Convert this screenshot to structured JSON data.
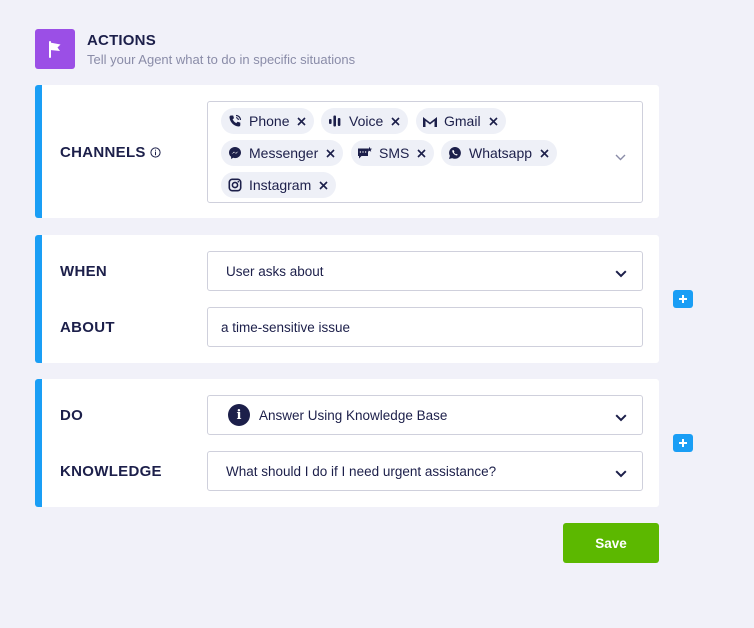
{
  "header": {
    "title": "ACTIONS",
    "subtitle": "Tell your Agent what to do in specific situations",
    "icon": "flag-icon",
    "icon_color": "#9b4fe6"
  },
  "channels": {
    "label": "CHANNELS",
    "chips": [
      {
        "label": "Phone",
        "icon": "phone-icon"
      },
      {
        "label": "Voice",
        "icon": "voice-icon"
      },
      {
        "label": "Gmail",
        "icon": "gmail-icon"
      },
      {
        "label": "Messenger",
        "icon": "messenger-icon"
      },
      {
        "label": "SMS",
        "icon": "sms-icon"
      },
      {
        "label": "Whatsapp",
        "icon": "whatsapp-icon"
      },
      {
        "label": "Instagram",
        "icon": "instagram-icon"
      }
    ]
  },
  "when": {
    "label": "WHEN",
    "value": "User asks about"
  },
  "about": {
    "label": "ABOUT",
    "value": "a time-sensitive issue"
  },
  "do": {
    "label": "DO",
    "value": "Answer Using Knowledge Base"
  },
  "knowledge": {
    "label": "KNOWLEDGE",
    "value": "What should I do if I need urgent assistance?"
  },
  "save_label": "Save",
  "colors": {
    "accent": "#1a9ef5",
    "save": "#5cb800",
    "background": "#f1f1f9"
  }
}
